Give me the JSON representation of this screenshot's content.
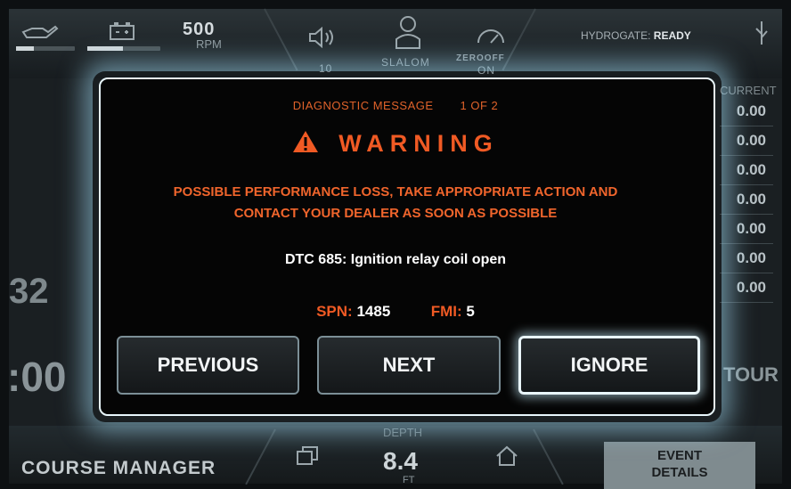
{
  "top": {
    "rpm_value": "500",
    "rpm_unit": "RPM",
    "volume_level": "10",
    "mode": "SLALOM",
    "zero_off_label": "ZEROOFF",
    "zero_off_state": "ON",
    "hydrogate_label": "HYDROGATE:",
    "hydrogate_status": "READY"
  },
  "side": {
    "current_title": "CURRENT",
    "current_values": [
      "0.00",
      "0.00",
      "0.00",
      "0.00",
      "0.00",
      "0.00",
      "0.00"
    ],
    "left_number": "32",
    "left_time": ":00",
    "tour_text": "TOUR"
  },
  "bottom": {
    "course_manager": "COURSE MANAGER",
    "depth_label": "DEPTH",
    "depth_value": "8.4",
    "depth_unit": "FT",
    "event_details_line1": "EVENT",
    "event_details_line2": "DETAILS"
  },
  "dialog": {
    "header": "DIAGNOSTIC MESSAGE",
    "page": "1  OF  2",
    "title": "WARNING",
    "message_line1": "POSSIBLE PERFORMANCE LOSS, TAKE APPROPRIATE ACTION AND",
    "message_line2": "CONTACT YOUR DEALER AS SOON AS POSSIBLE",
    "dtc": "DTC 685: Ignition relay coil open",
    "spn_label": "SPN:",
    "spn_value": "1485",
    "fmi_label": "FMI:",
    "fmi_value": "5",
    "buttons": {
      "previous": "PREVIOUS",
      "next": "NEXT",
      "ignore": "IGNORE"
    }
  },
  "icons": {
    "oil": "oil-can-icon",
    "battery": "battery-icon",
    "speaker": "speaker-icon",
    "driver": "driver-icon",
    "zero_off": "speedometer-icon",
    "usb": "usb-icon",
    "screens": "screens-icon",
    "home": "home-icon",
    "warning": "warning-triangle-icon"
  },
  "colors": {
    "warning_orange": "#f05a24",
    "glow": "#aae6ff"
  }
}
